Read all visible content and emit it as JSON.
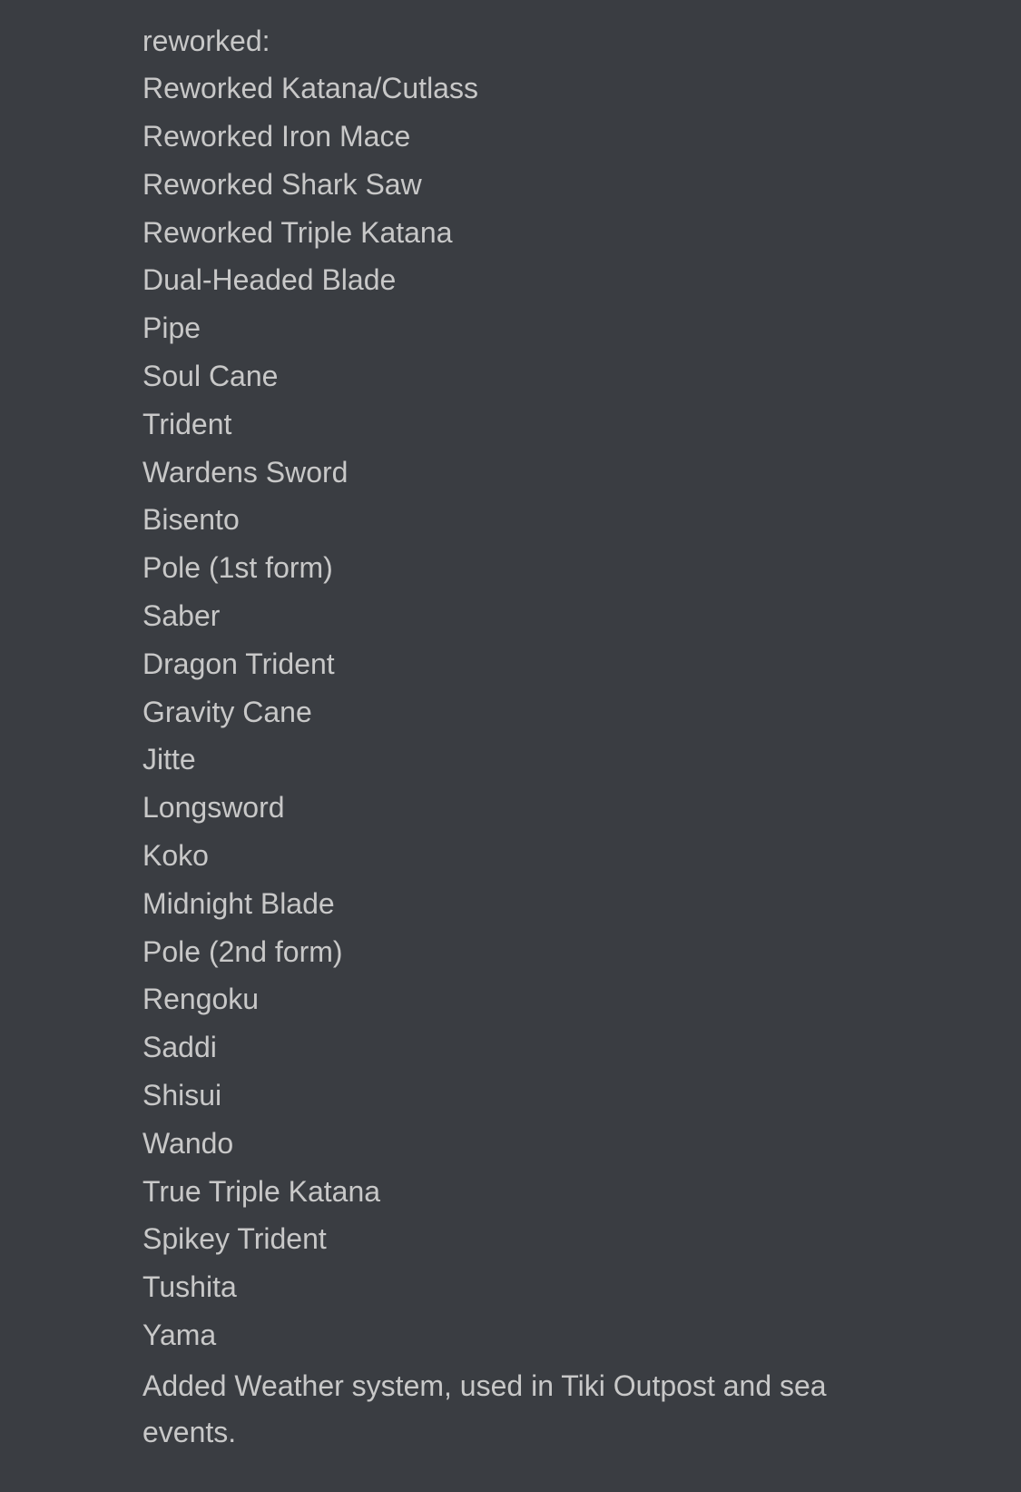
{
  "header": {
    "label": "reworked:"
  },
  "items": [
    {
      "text": "Reworked Katana/Cutlass"
    },
    {
      "text": "Reworked Iron Mace"
    },
    {
      "text": "Reworked Shark Saw"
    },
    {
      "text": "Reworked Triple Katana"
    },
    {
      "text": "Dual-Headed Blade"
    },
    {
      "text": "Pipe"
    },
    {
      "text": "Soul Cane"
    },
    {
      "text": "Trident"
    },
    {
      "text": "Wardens Sword"
    },
    {
      "text": "Bisento"
    },
    {
      "text": "Pole (1st form)"
    },
    {
      "text": "Saber"
    },
    {
      "text": "Dragon Trident"
    },
    {
      "text": "Gravity Cane"
    },
    {
      "text": "Jitte"
    },
    {
      "text": "Longsword"
    },
    {
      "text": "Koko"
    },
    {
      "text": "Midnight Blade"
    },
    {
      "text": "Pole (2nd form)"
    },
    {
      "text": "Rengoku"
    },
    {
      "text": "Saddi"
    },
    {
      "text": "Shisui"
    },
    {
      "text": "Wando"
    },
    {
      "text": "True Triple Katana"
    },
    {
      "text": "Spikey Trident"
    },
    {
      "text": "Tushita"
    },
    {
      "text": "Yama"
    }
  ],
  "footer": {
    "text": "Added Weather system, used in Tiki Outpost and sea events."
  }
}
